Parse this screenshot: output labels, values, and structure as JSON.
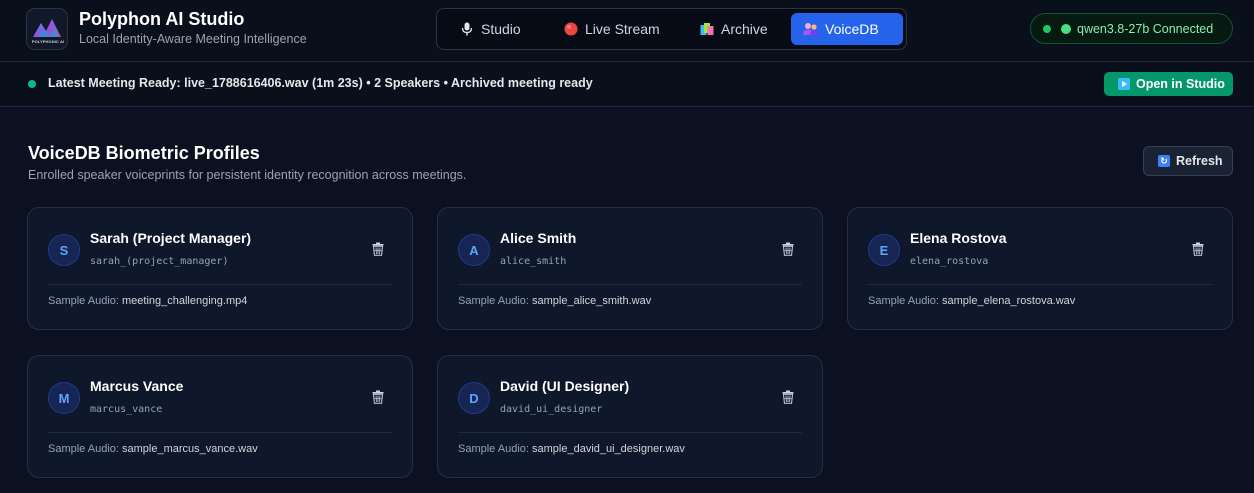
{
  "app": {
    "title": "Polyphon AI Studio",
    "subtitle": "Local Identity-Aware Meeting Intelligence",
    "logo_text": "POLYPHONIC AI"
  },
  "nav": {
    "tabs": [
      {
        "label": "Studio",
        "icon": "microphone-icon",
        "active": false
      },
      {
        "label": "Live Stream",
        "icon": "record-icon",
        "active": false
      },
      {
        "label": "Archive",
        "icon": "archive-icon",
        "active": false
      },
      {
        "label": "VoiceDB",
        "icon": "people-icon",
        "active": true
      }
    ]
  },
  "status": {
    "text": "qwen3.8-27b Connected",
    "color": "#22c55e"
  },
  "banner": {
    "text": "Latest Meeting Ready: live_1788616406.wav (1m 23s) • 2 Speakers • Archived meeting ready",
    "button_label": "Open in Studio"
  },
  "section": {
    "title": "VoiceDB Biometric Profiles",
    "subtitle": "Enrolled speaker voiceprints for persistent identity recognition across meetings.",
    "refresh_label": "Refresh",
    "sample_prefix": "Sample Audio:"
  },
  "profiles": [
    {
      "initial": "S",
      "name": "Sarah (Project Manager)",
      "id": "sarah_(project_manager)",
      "sample": "meeting_challenging.mp4"
    },
    {
      "initial": "A",
      "name": "Alice Smith",
      "id": "alice_smith",
      "sample": "sample_alice_smith.wav"
    },
    {
      "initial": "E",
      "name": "Elena Rostova",
      "id": "elena_rostova",
      "sample": "sample_elena_rostova.wav"
    },
    {
      "initial": "M",
      "name": "Marcus Vance",
      "id": "marcus_vance",
      "sample": "sample_marcus_vance.wav"
    },
    {
      "initial": "D",
      "name": "David (UI Designer)",
      "id": "david_ui_designer",
      "sample": "sample_david_ui_designer.wav"
    }
  ],
  "colors": {
    "accent": "#2563eb",
    "success": "#059669",
    "background": "#0b1120"
  }
}
